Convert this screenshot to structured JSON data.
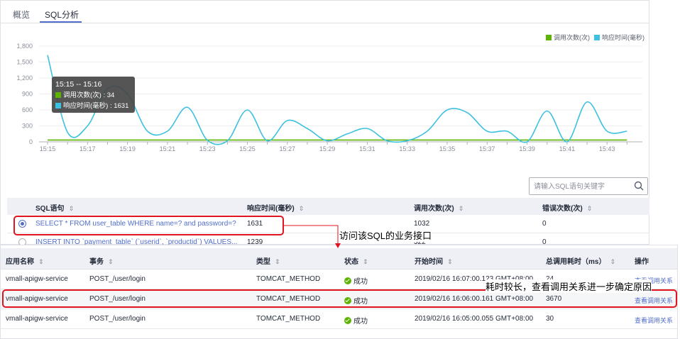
{
  "tabs": [
    {
      "label": "概览",
      "active": false
    },
    {
      "label": "SQL分析",
      "active": true
    }
  ],
  "chart_data": {
    "type": "line",
    "x": [
      "15:15",
      "15:16",
      "15:17",
      "15:18",
      "15:19",
      "15:20",
      "15:21",
      "15:22",
      "15:23",
      "15:24",
      "15:25",
      "15:26",
      "15:27",
      "15:28",
      "15:29",
      "15:30",
      "15:31",
      "15:32",
      "15:33",
      "15:34",
      "15:35",
      "15:36",
      "15:37",
      "15:38",
      "15:39",
      "15:40",
      "15:41",
      "15:42",
      "15:43",
      "15:44"
    ],
    "x_tick_labels": [
      "15:15",
      "15:17",
      "15:19",
      "15:21",
      "15:23",
      "15:25",
      "15:27",
      "15:29",
      "15:31",
      "15:33",
      "15:35",
      "15:37",
      "15:39",
      "15:41",
      "15:43"
    ],
    "y_ticks": [
      0,
      300,
      600,
      900,
      1200,
      1500,
      1800
    ],
    "y_tick_labels": [
      "0",
      "300",
      "600",
      "900",
      "1,200",
      "1,500",
      "1,800"
    ],
    "ylim": [
      0,
      1800
    ],
    "series": [
      {
        "name": "调用次数(次)",
        "color": "#5cb300",
        "values": [
          34,
          34,
          34,
          34,
          34,
          34,
          34,
          34,
          34,
          34,
          34,
          34,
          34,
          34,
          34,
          34,
          34,
          34,
          34,
          34,
          34,
          34,
          34,
          34,
          34,
          34,
          34,
          34,
          34,
          34
        ]
      },
      {
        "name": "响应时间(毫秒)",
        "color": "#3cc1e0",
        "values": [
          1631,
          180,
          300,
          1000,
          900,
          200,
          200,
          650,
          30,
          20,
          600,
          20,
          400,
          250,
          20,
          150,
          250,
          20,
          20,
          200,
          600,
          550,
          200,
          200,
          0,
          580,
          0,
          750,
          200,
          200
        ]
      }
    ],
    "legend_position": "top-right",
    "grid": true,
    "tooltip": {
      "title": "15:15 -- 15:16",
      "rows": [
        {
          "label": "调用次数(次) : 34",
          "color": "#5cb300"
        },
        {
          "label": "响应时间(毫秒) : 1631",
          "color": "#3cc1e0"
        }
      ]
    }
  },
  "search": {
    "placeholder": "请输入SQL语句关键字"
  },
  "sql_table": {
    "headers": [
      "SQL语句",
      "响应时间(毫秒)",
      "调用次数(次)",
      "错误次数(次)"
    ],
    "sort_glyph": "⇕",
    "rows": [
      {
        "sql": "SELECT * FROM user_table WHERE name=? and password=?",
        "resp": "1631",
        "calls": "1032",
        "errors": "0",
        "selected": true
      },
      {
        "sql": "INSERT INTO `payment_table` (`userid`, `productid`) VALUES...",
        "resp": "1239",
        "calls": "322",
        "errors": "0",
        "selected": false
      }
    ]
  },
  "trace_table": {
    "headers": [
      "应用名称",
      "事务",
      "类型",
      "状态",
      "开始时间",
      "总调用耗时（ms）",
      "操作"
    ],
    "rows": [
      {
        "app": "vmall-apigw-service",
        "txn": "POST_/user/login",
        "type": "TOMCAT_METHOD",
        "status": "成功",
        "start": "2019/02/16 16:07:00.123 GMT+08:00",
        "cost": "24",
        "op": "查看调用关系"
      },
      {
        "app": "vmall-apigw-service",
        "txn": "POST_/user/login",
        "type": "TOMCAT_METHOD",
        "status": "成功",
        "start": "2019/02/16 16:06:00.161 GMT+08:00",
        "cost": "3670",
        "op": "查看调用关系"
      },
      {
        "app": "vmall-apigw-service",
        "txn": "POST_/user/login",
        "type": "TOMCAT_METHOD",
        "status": "成功",
        "start": "2019/02/16 16:05:00.055 GMT+08:00",
        "cost": "30",
        "op": "查看调用关系"
      }
    ]
  },
  "annotations": {
    "sql_callout": "访问该SQL的业务接口",
    "slow_callout": "耗时较长，查看调用关系进一步确定原因",
    "color": "#e0141e"
  }
}
